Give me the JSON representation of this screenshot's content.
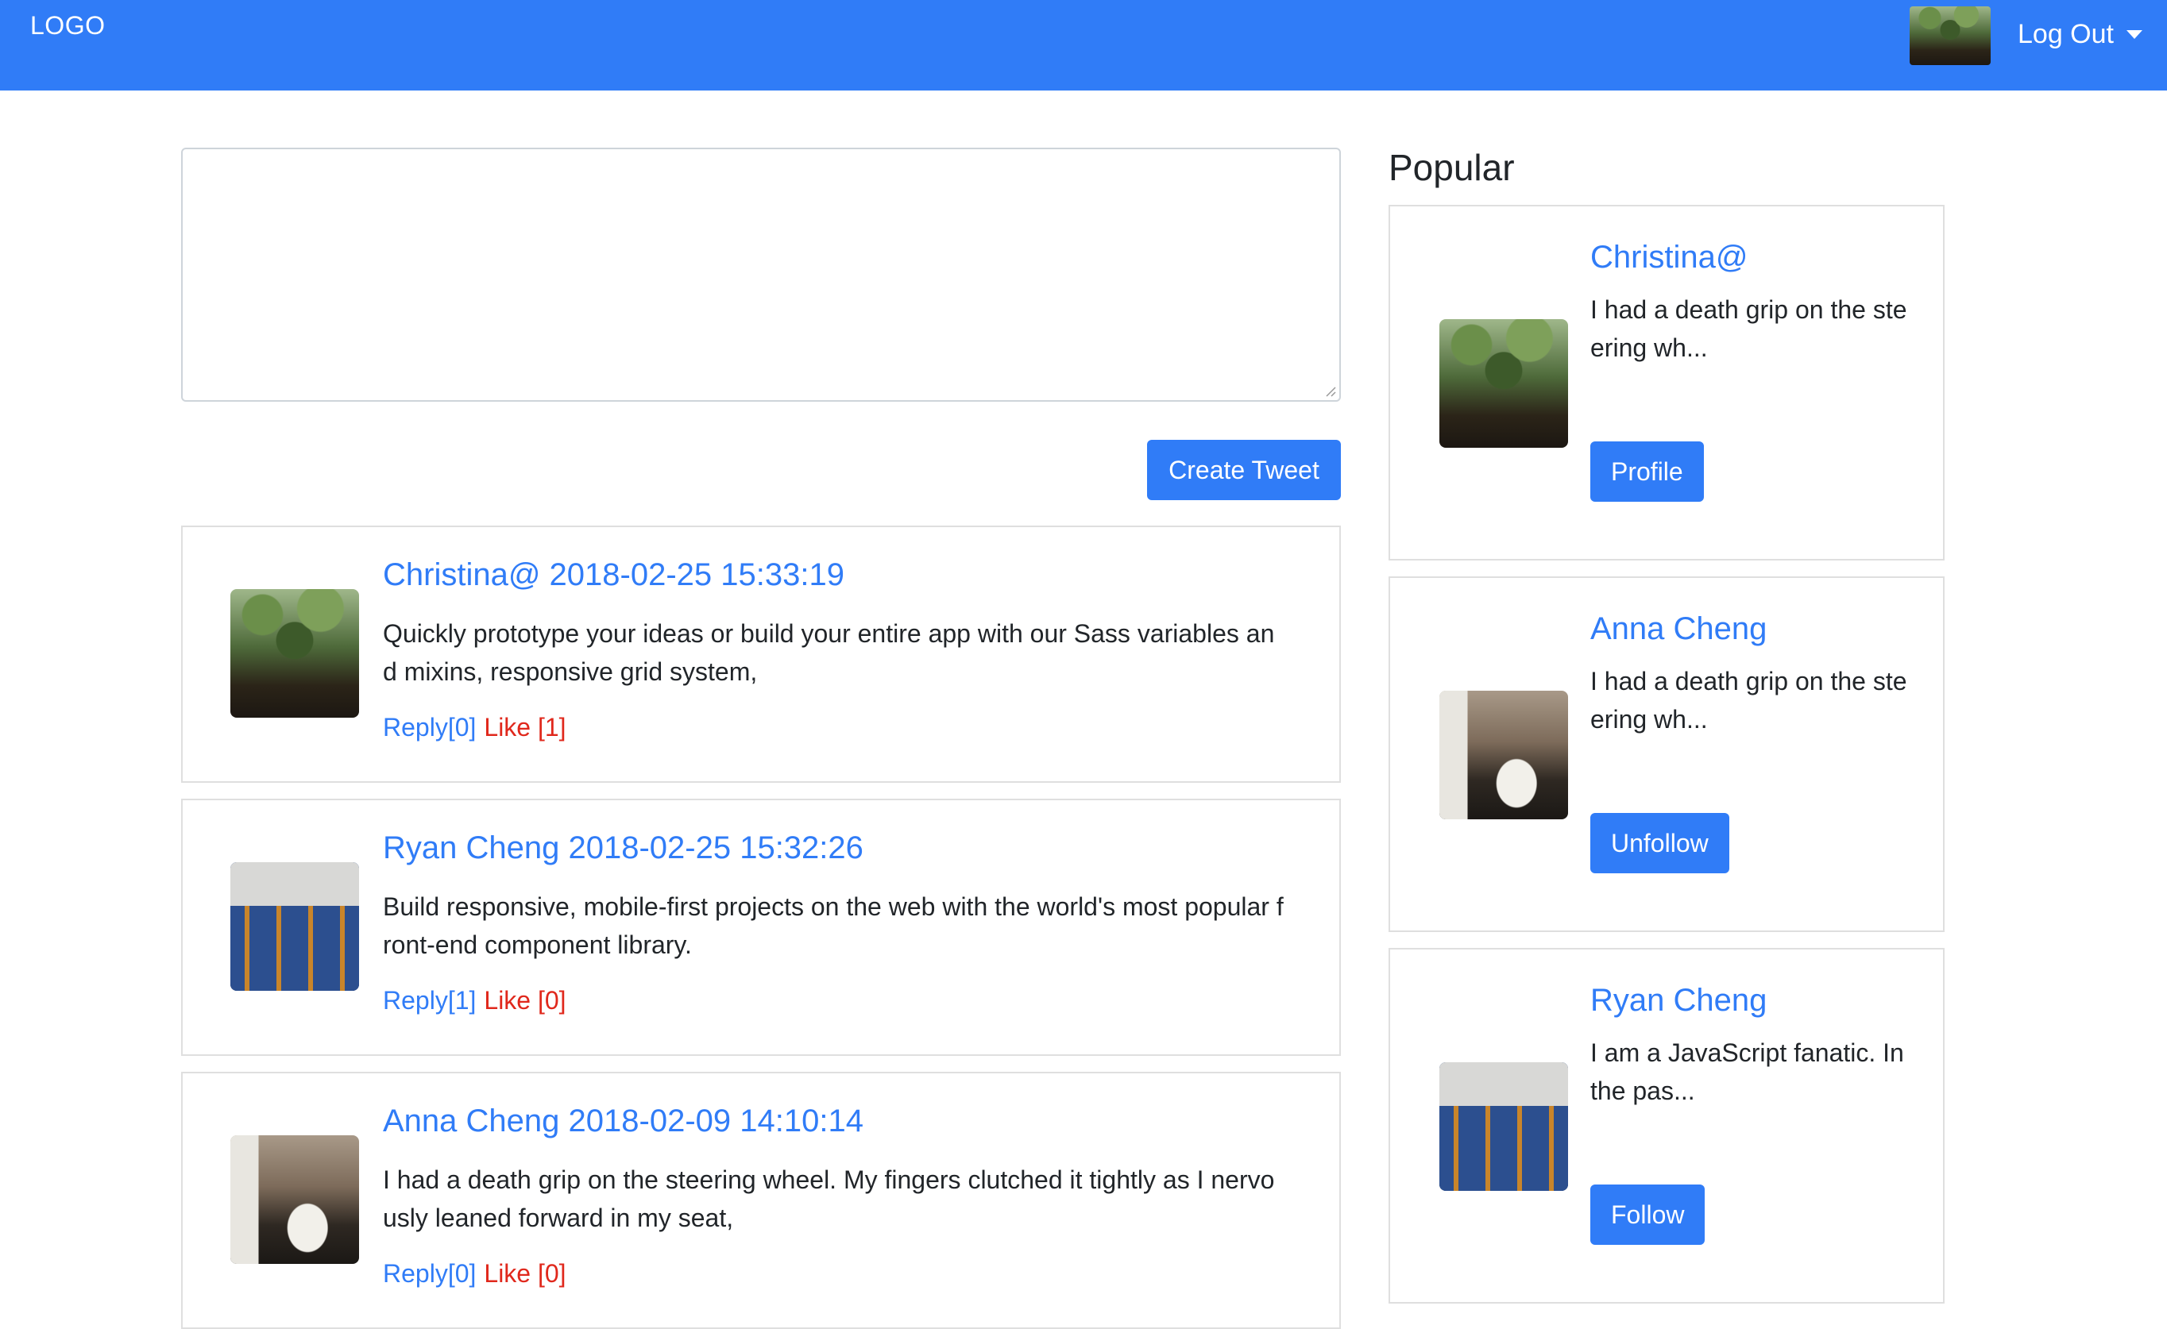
{
  "navbar": {
    "logo": "LOGO",
    "logout_label": "Log Out",
    "avatar_icon": "user-avatar-palm-photo"
  },
  "compose": {
    "value": "",
    "button_label": "Create Tweet"
  },
  "tweets": [
    {
      "header": "Christina@ 2018-02-25 15:33:19",
      "text": "Quickly prototype your ideas or build your entire app with our Sass variables and mixins, responsive grid system,",
      "reply": "Reply[0]",
      "like": "Like [1]",
      "photo": "palm"
    },
    {
      "header": "Ryan Cheng 2018-02-25 15:32:26",
      "text": "Build responsive, mobile-first projects on the web with the world's most popular front-end component library.",
      "reply": "Reply[1]",
      "like": "Like [0]",
      "photo": "building"
    },
    {
      "header": "Anna Cheng 2018-02-09 14:10:14",
      "text": "I had a death grip on the steering wheel. My fingers clutched it tightly as I nervously leaned forward in my seat,",
      "reply": "Reply[0]",
      "like": "Like [0]",
      "photo": "room"
    }
  ],
  "popular": {
    "title": "Popular",
    "users": [
      {
        "name": "Christina@",
        "bio": "I had a death grip on the steering wh...",
        "button": "Profile",
        "photo": "palm"
      },
      {
        "name": "Anna Cheng",
        "bio": "I had a death grip on the steering wh...",
        "button": "Unfollow",
        "photo": "room"
      },
      {
        "name": "Ryan Cheng",
        "bio": "I am a JavaScript fanatic. In the pas...",
        "button": "Follow",
        "photo": "building"
      }
    ]
  },
  "colors": {
    "primary": "#307cf7",
    "like_red": "#e0281c",
    "border": "#dfdfdf"
  }
}
